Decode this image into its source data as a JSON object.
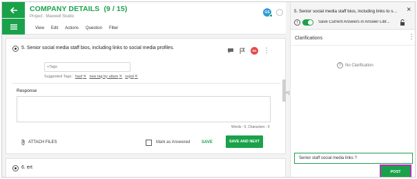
{
  "header": {
    "title": "COMPANY DETAILS",
    "progress": "(9 / 15)",
    "project": "Project : Maxwell Studio",
    "menu": [
      "View",
      "Edit",
      "Actions",
      "Question",
      "Filter"
    ],
    "avatar_initials": "GS"
  },
  "question5": {
    "text": "5. Senior social media staff bios, including links to social media profiles.",
    "assignee_initials": "SK",
    "tags_placeholder": "+Tags",
    "suggested_label": "Suggested Tags:",
    "suggested_tags": [
      "hasf",
      "new tag by uttam",
      "ssjsd"
    ],
    "response_label": "Response",
    "counter": "Words : 0, Characters : 0",
    "attach_label": "ATTACH FILES",
    "mark_answered_label": "Mark as Answered",
    "mark_answered_checked": false,
    "save_label": "SAVE",
    "save_next_label": "SAVE AND NEXT"
  },
  "question6": {
    "text": "6. ert"
  },
  "panel": {
    "title": "5. Senior social media staff bios, including links to so...",
    "toggle_label": "Save Current Answers in Answer Libr...",
    "toggle_on": true,
    "clarifications_label": "Clarifications",
    "empty_text": "No Clarification",
    "comment_value": "Senior staff social media links ?",
    "post_label": "POST"
  },
  "colors": {
    "brand_green": "#1aa24a",
    "highlight_purple": "#b233b6",
    "badge_red": "#e34b4b",
    "avatar_blue": "#2d9bd4"
  },
  "icons": [
    "back-arrow-icon",
    "hamburger-icon",
    "comment-icon",
    "flag-icon",
    "kebab-icon",
    "paperclip-icon",
    "info-icon",
    "lock-icon",
    "close-icon",
    "question-circle-icon"
  ]
}
